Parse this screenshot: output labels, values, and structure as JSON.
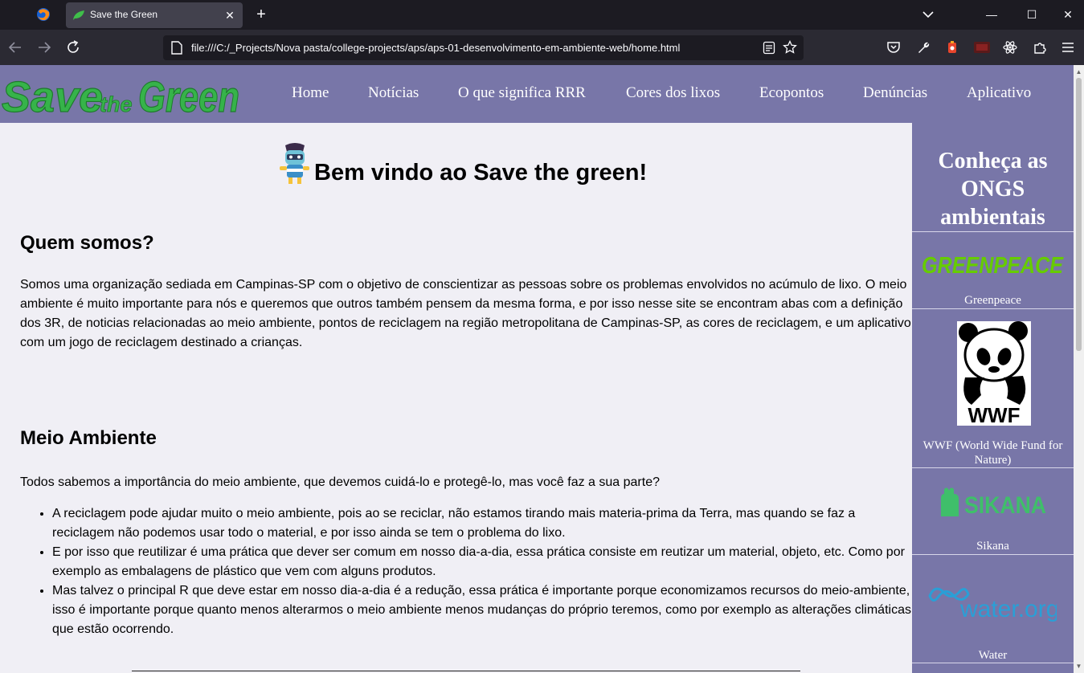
{
  "browser": {
    "tab_title": "Save the Green",
    "url": "file:///C:/_Projects/Nova pasta/college-projects/aps/aps-01-desenvolvimento-em-ambiente-web/home.html",
    "new_tab_symbol": "+",
    "tab_close_symbol": "✕",
    "window": {
      "minimize": "—",
      "maximize": "☐",
      "close": "✕"
    }
  },
  "header": {
    "logo": {
      "save": "Save",
      "the": "the",
      "green": "Green"
    },
    "nav": [
      "Home",
      "Notícias",
      "O que significa RRR",
      "Cores dos lixos",
      "Ecopontos",
      "Denúncias",
      "Aplicativo"
    ]
  },
  "main": {
    "welcome": "Bem vindo ao Save the green!",
    "about_heading": "Quem somos?",
    "about_text": "Somos uma organização sediada em Campinas-SP com o objetivo de conscientizar as pessoas sobre os problemas envolvidos no acúmulo de lixo. O meio ambiente é muito importante para nós e queremos que outros também pensem da mesma forma, e por isso nesse site se encontram abas com a definição dos 3R, de noticias relacionadas ao meio ambiente, pontos de reciclagem na região metropolitana de Campinas-SP, as cores de reciclagem, e um aplicativo com um jogo de reciclagem destinado a crianças.",
    "env_heading": "Meio Ambiente",
    "env_intro": "Todos sabemos a importância do meio ambiente, que devemos cuidá-lo e protegê-lo, mas você faz a sua parte?",
    "env_items": [
      "A reciclagem pode ajudar muito o meio ambiente, pois ao se reciclar, não estamos tirando mais materia-prima da Terra, mas quando se faz a reciclagem não podemos usar todo o material, e por isso ainda se tem o problema do lixo.",
      "E por isso que reutilizar é uma prática que dever ser comum em nosso dia-a-dia, essa prática consiste em reutizar um material, objeto, etc. Como por exemplo as embalagens de plástico que vem com alguns produtos.",
      "Mas talvez o principal R que deve estar em nosso dia-a-dia é a redução, essa prática é importante porque economizamos recursos do meio-ambiente, isso é importante porque quanto menos alterarmos o meio ambiente menos mudanças do próprio teremos, como por exemplo as alterações climáticas que estão ocorrendo."
    ]
  },
  "aside": {
    "title": "Conheça as ONGS ambientais",
    "ongs": [
      {
        "logo_text": "GREENPEACE",
        "name": "Greenpeace"
      },
      {
        "logo_text": "WWF",
        "name": "WWF (World Wide Fund for Nature)"
      },
      {
        "logo_text": "SIKANA",
        "name": "Sikana"
      },
      {
        "logo_text": "water.org",
        "name": "Water"
      }
    ]
  },
  "colors": {
    "header_bg": "#7876a8",
    "page_bg": "#f0eff5",
    "logo_green": "#36b34a",
    "greenpeace_green": "#66cc00",
    "sikana_green": "#3fbf6a",
    "water_blue": "#2a9fd6"
  }
}
